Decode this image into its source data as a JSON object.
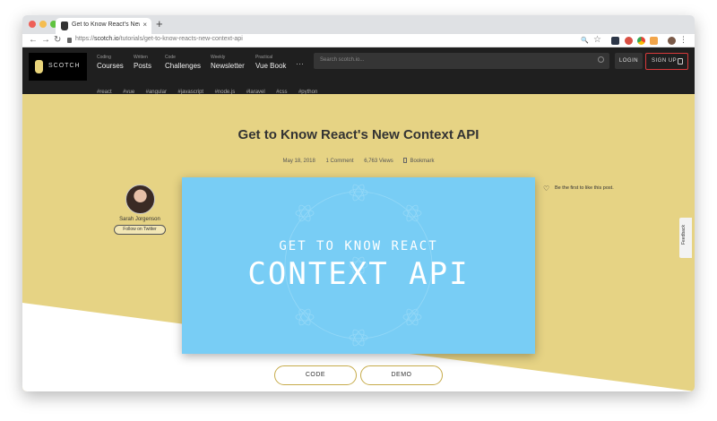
{
  "browser": {
    "tab_title": "Get to Know React's New Conte",
    "tab_close": "×",
    "new_tab": "+",
    "url_scheme": "https://",
    "url_host": "scotch.io",
    "url_path": "/tutorials/get-to-know-reacts-new-context-api",
    "back_icon": "←",
    "forward_icon": "→",
    "reload_icon": "↻",
    "zoom_icon": "🔍",
    "star_icon": "☆",
    "menu_icon": "⋮"
  },
  "site": {
    "logo_text": "SCOTCH",
    "nav": [
      {
        "small": "Coding",
        "label": "Courses"
      },
      {
        "small": "Written",
        "label": "Posts"
      },
      {
        "small": "Code",
        "label": "Challenges"
      },
      {
        "small": "Weekly",
        "label": "Newsletter"
      },
      {
        "small": "Practical",
        "label": "Vue Book"
      }
    ],
    "more_label": "···",
    "search_placeholder": "Search scotch.io...",
    "login_label": "LOGIN",
    "signup_label": "SIGN UP",
    "tags": [
      "#react",
      "#vue",
      "#angular",
      "#javascript",
      "#node.js",
      "#laravel",
      "#css",
      "#python"
    ]
  },
  "article": {
    "title": "Get to Know React's New Context API",
    "date": "May 18, 2018",
    "comments": "1 Comment",
    "views": "6,763 Views",
    "bookmark_label": "Bookmark",
    "author_name": "Sarah Jorgenson",
    "follow_label": "Follow on Twitter",
    "hero_sub": "GET TO KNOW REACT",
    "hero_main": "CONTEXT API",
    "like_heart": "♡",
    "like_text": "Be the first to like this post.",
    "feedback_label": "Feedback",
    "code_label": "CODE",
    "demo_label": "DEMO"
  },
  "colors": {
    "accent_yellow": "#e6d384",
    "hero_blue": "#78cdf5",
    "nav_dark": "#1f1f1f",
    "signup_border": "#d8393b"
  }
}
